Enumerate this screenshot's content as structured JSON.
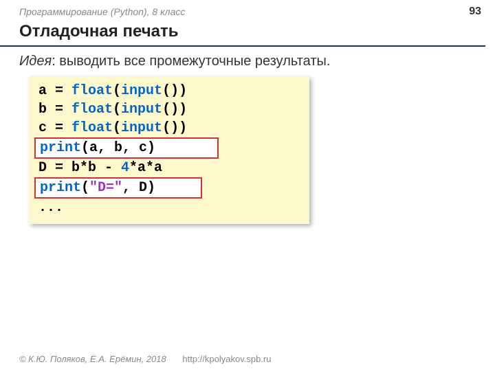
{
  "header": {
    "course": "Программирование (Python), 8 класс",
    "page": "93"
  },
  "title": "Отладочная печать",
  "idea": {
    "label": "Идея",
    "text": ": выводить все промежуточные результаты."
  },
  "code": {
    "l1_a": "a = ",
    "l1_float": "float",
    "l1_p1": "(",
    "l1_input": "input",
    "l1_p2": "())",
    "l2_a": "b = ",
    "l2_float": "float",
    "l2_p1": "(",
    "l2_input": "input",
    "l2_p2": "())",
    "l3_a": "c = ",
    "l3_float": "float",
    "l3_p1": "(",
    "l3_input": "input",
    "l3_p2": "())",
    "l4_print": "print",
    "l4_args": "(a, b, c)",
    "l5_a": "D = b*b - ",
    "l5_num": "4",
    "l5_b": "*a*a",
    "l6_print": "print",
    "l6_p1": "(",
    "l6_str": "\"D=\"",
    "l6_p2": ", D)",
    "l7": "..."
  },
  "footer": {
    "copyright": "© К.Ю. Поляков, Е.А. Ерёмин, 2018",
    "url": "http://kpolyakov.spb.ru"
  }
}
